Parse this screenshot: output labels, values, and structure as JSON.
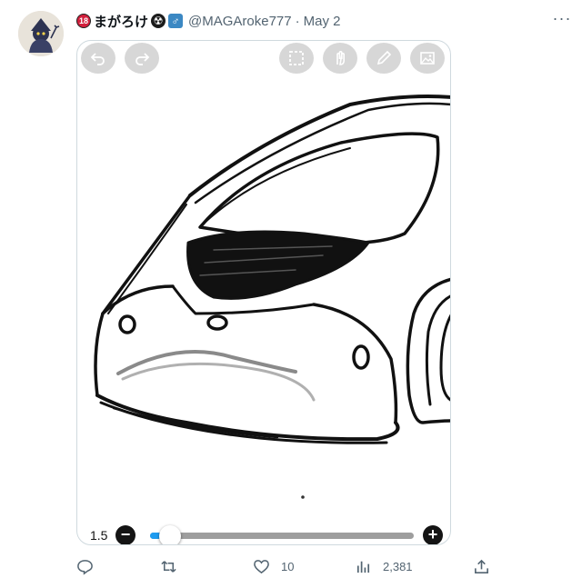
{
  "post": {
    "badge_label": "18",
    "display_name": "まがろけ",
    "emoji_warning": "☢",
    "emoji_male": "♂",
    "handle": "@MAGAroke777",
    "separator": "·",
    "date": "May 2",
    "more_label": "···"
  },
  "canvas_tools": {
    "top_buttons": [
      "undo-icon",
      "redo-icon",
      "selection-icon",
      "hand-icon",
      "pen-icon",
      "image-icon"
    ],
    "brush_size": "1.5",
    "minus_label": "−",
    "plus_label": "+",
    "brush_slider_level": 0.04,
    "accent": "#1d9bf0"
  },
  "actions": {
    "reply_count": "",
    "repost_count": "",
    "like_count": "10",
    "views_count": "2,381"
  },
  "colors": {
    "text_primary": "#0f1419",
    "text_secondary": "#536471",
    "border": "#cfd9de"
  }
}
